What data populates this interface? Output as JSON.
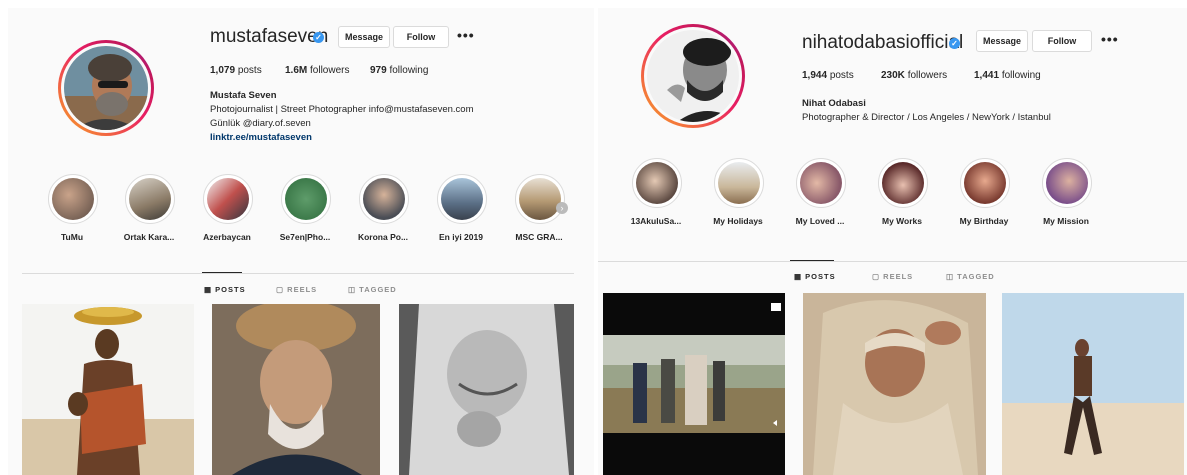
{
  "left": {
    "username": "mustafaseven",
    "buttons": {
      "message": "Message",
      "follow": "Follow",
      "more": "•••"
    },
    "stats": {
      "posts_num": "1,079",
      "posts_label": "posts",
      "followers_num": "1.6M",
      "followers_label": "followers",
      "following_num": "979",
      "following_label": "following"
    },
    "name": "Mustafa Seven",
    "bio_lines": [
      "Photojournalist | Street Photographer info@mustafaseven.com",
      "Günlük @diary.of.seven"
    ],
    "link": "linktr.ee/mustafaseven",
    "highlights": [
      "TuMu",
      "Ortak Kara...",
      "Azerbaycan",
      "Se7en|Pho...",
      "Korona Po...",
      "En iyi 2019",
      "MSC GRA..."
    ],
    "tabs": {
      "posts": "POSTS",
      "reels": "REELS",
      "tagged": "TAGGED"
    }
  },
  "right": {
    "username": "nihatodabasiofficial",
    "buttons": {
      "message": "Message",
      "follow": "Follow",
      "more": "•••"
    },
    "stats": {
      "posts_num": "1,944",
      "posts_label": "posts",
      "followers_num": "230K",
      "followers_label": "followers",
      "following_num": "1,441",
      "following_label": "following"
    },
    "name": "Nihat Odabasi",
    "bio_lines": [
      "Photographer & Director / Los Angeles / NewYork / Istanbul"
    ],
    "highlights": [
      "13AkuluSa...",
      "My Holidays",
      "My Loved ...",
      "My Works",
      "My Birthday",
      "My Mission"
    ],
    "tabs": {
      "posts": "POSTS",
      "reels": "REELS",
      "tagged": "TAGGED"
    }
  },
  "colors": {
    "accent": "#3897f0",
    "link": "#00376b",
    "border": "#dbdbdb",
    "muted": "#8e8e8e"
  }
}
